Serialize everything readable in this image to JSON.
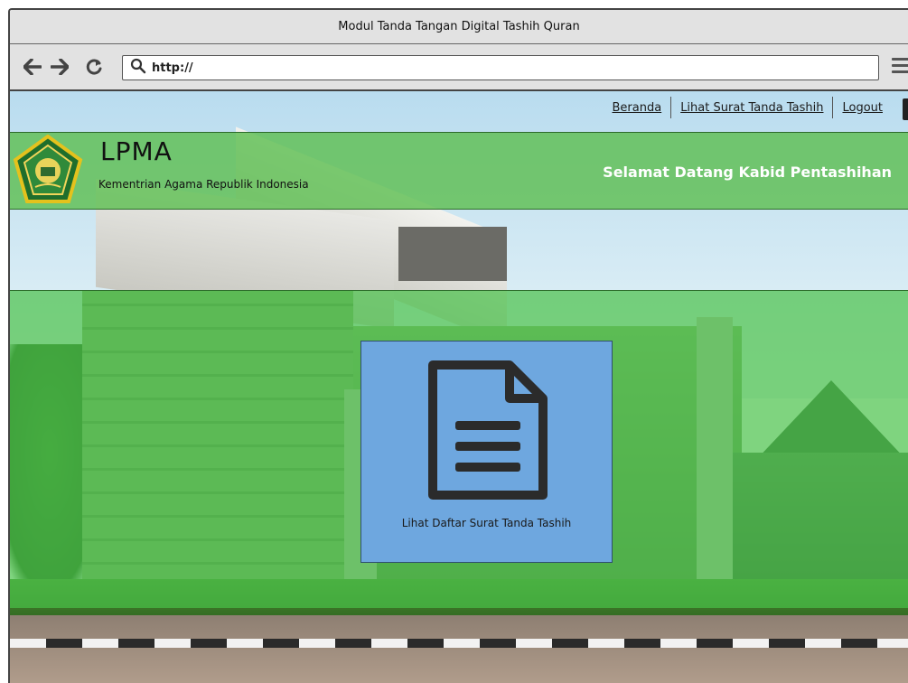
{
  "window": {
    "title": "Modul Tanda Tangan Digital Tashih Quran"
  },
  "browser": {
    "back_icon": "arrow-left-icon",
    "forward_icon": "arrow-right-icon",
    "reload_icon": "reload-icon",
    "search_icon": "search-icon",
    "menu_icon": "hamburger-menu-icon",
    "address": "http://"
  },
  "nav": {
    "links": [
      {
        "label": "Beranda"
      },
      {
        "label": "Lihat Surat Tanda Tashih"
      },
      {
        "label": "Logout"
      }
    ]
  },
  "header": {
    "brand": "LPMA",
    "subtitle": "Kementrian Agama Republik Indonesia",
    "welcome": "Selamat Datang Kabid Pentashihan",
    "logo_icon": "kemenag-emblem-icon"
  },
  "main": {
    "card": {
      "icon": "document-icon",
      "label": "Lihat Daftar Surat Tanda Tashih"
    }
  },
  "colors": {
    "header_green": "#5ebe52",
    "content_green": "#48c248",
    "card_blue": "#6ea7df",
    "welcome_text": "#ffffff"
  }
}
